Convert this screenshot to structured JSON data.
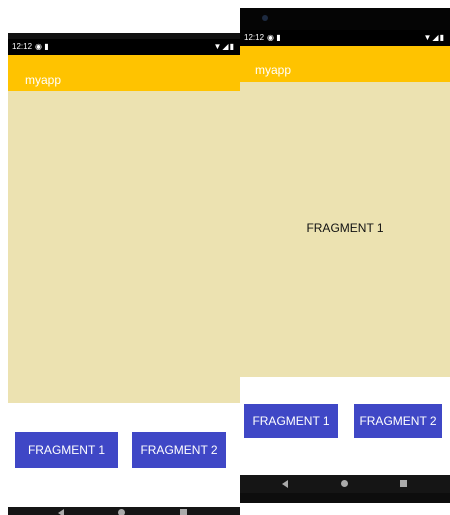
{
  "colors": {
    "toolbar": "#ffc300",
    "fragment_background": "#ece2b1",
    "button": "#3f47c6",
    "button_text": "#ffffff",
    "status_bar": "#000000",
    "nav_bar": "#151515"
  },
  "left_phone": {
    "status_time": "12:12",
    "status_left_icons": "◉ ▮",
    "status_right_icons": "▼◢▮",
    "app_title": "myapp",
    "fragment_text": "",
    "buttons": {
      "fragment1": "FRAGMENT 1",
      "fragment2": "FRAGMENT 2"
    }
  },
  "right_phone": {
    "status_time": "12:12",
    "status_left_icons": "◉ ▮",
    "status_right_icons": "▼◢▮",
    "app_title": "myapp",
    "fragment_text": "FRAGMENT 1",
    "buttons": {
      "fragment1": "FRAGMENT 1",
      "fragment2": "FRAGMENT 2"
    }
  },
  "icons": {
    "nav_back": "back-triangle-icon",
    "nav_home": "home-circle-icon",
    "nav_recent": "recents-square-icon"
  }
}
